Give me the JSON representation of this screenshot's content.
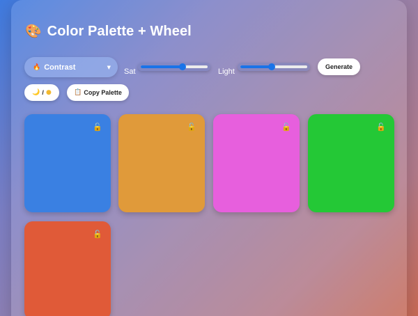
{
  "app": {
    "title": "Color Palette + Wheel",
    "title_icon": "palette-icon"
  },
  "controls": {
    "mode_select": {
      "value": "Contrast",
      "icon": "fire-icon"
    },
    "sat": {
      "label": "Sat",
      "value": 0.62
    },
    "light": {
      "label": "Light",
      "value": 0.47
    },
    "generate_label": "Generate",
    "theme_toggle": {
      "label": "/",
      "icons": [
        "moon-icon",
        "sun-icon"
      ]
    },
    "copy_palette": {
      "label": "Copy Palette",
      "icon": "clipboard-icon"
    }
  },
  "palette": [
    {
      "color": "#3a80e2",
      "locked": false,
      "lock_icon": "unlocked-icon"
    },
    {
      "color": "#e09a3a",
      "locked": false,
      "lock_icon": "unlocked-icon"
    },
    {
      "color": "#e75fdd",
      "locked": false,
      "lock_icon": "unlocked-icon"
    },
    {
      "color": "#24c836",
      "locked": false,
      "lock_icon": "unlocked-icon"
    },
    {
      "color": "#e05a38",
      "locked": false,
      "lock_icon": "unlocked-icon"
    }
  ]
}
